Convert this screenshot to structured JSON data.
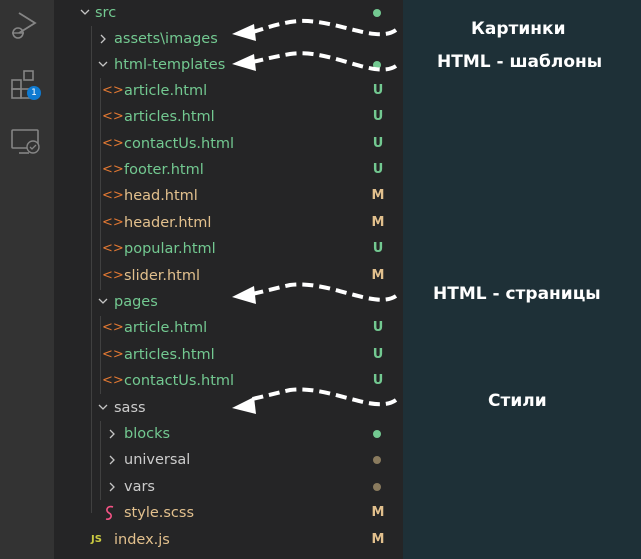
{
  "activity_bar": {
    "icons": [
      "run-debug-icon",
      "extensions-icon",
      "remote-explorer-icon"
    ],
    "extensions_badge": "1"
  },
  "tree": {
    "src": {
      "label": "src",
      "status_color": "#73c991"
    },
    "assets": {
      "label": "assets\\images"
    },
    "html_templates": {
      "label": "html-templates"
    },
    "html_template_files": [
      {
        "label": "article.html",
        "status": "U"
      },
      {
        "label": "articles.html",
        "status": "U"
      },
      {
        "label": "contactUs.html",
        "status": "U"
      },
      {
        "label": "footer.html",
        "status": "U"
      },
      {
        "label": "head.html",
        "status": "M"
      },
      {
        "label": "header.html",
        "status": "M"
      },
      {
        "label": "popular.html",
        "status": "U"
      },
      {
        "label": "slider.html",
        "status": "M"
      }
    ],
    "pages": {
      "label": "pages"
    },
    "page_files": [
      {
        "label": "article.html",
        "status": "U"
      },
      {
        "label": "articles.html",
        "status": "U"
      },
      {
        "label": "contactUs.html",
        "status": "U"
      }
    ],
    "sass": {
      "label": "sass"
    },
    "sass_folders": [
      {
        "label": "blocks",
        "dot_color": "#73c991"
      },
      {
        "label": "universal",
        "dot_color": "#8a7b5e"
      },
      {
        "label": "vars",
        "dot_color": "#8a7b5e"
      }
    ],
    "style_scss": {
      "label": "style.scss",
      "status": "M"
    },
    "index_js": {
      "label": "index.js",
      "status": "M",
      "icon": "JS"
    }
  },
  "annotations": {
    "images": "Картинки",
    "templates": "HTML - шаблоны",
    "pages": "HTML - страницы",
    "styles": "Стили"
  },
  "colors": {
    "untracked": "#73c991",
    "modified": "#e2c08d",
    "html_icon": "#e37933",
    "scss_icon": "#f55385",
    "js_icon": "#cbcb41",
    "annotation_bg": "#1e3037"
  }
}
